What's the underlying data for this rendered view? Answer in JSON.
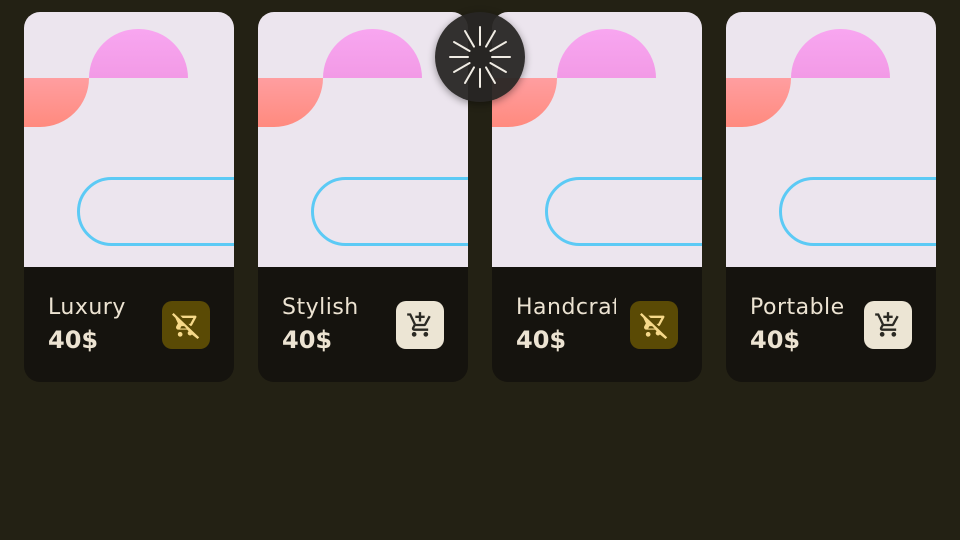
{
  "products": [
    {
      "title": "Luxury",
      "price": "40$",
      "in_cart": true,
      "cart_icon": "remove-shopping-cart-icon"
    },
    {
      "title": "Stylish",
      "price": "40$",
      "in_cart": false,
      "cart_icon": "add-shopping-cart-icon"
    },
    {
      "title": "Handcrafted",
      "price": "40$",
      "in_cart": true,
      "cart_icon": "remove-shopping-cart-icon"
    },
    {
      "title": "Portable",
      "price": "40$",
      "in_cart": false,
      "cart_icon": "add-shopping-cart-icon"
    }
  ],
  "loading_indicator": {
    "icon": "loading-spinner-icon"
  },
  "colors": {
    "background": "#232114",
    "card_info_bg": "#15130e",
    "image_bg": "#ece5ee",
    "in_cart_button": "#5a4a05",
    "in_cart_icon": "#f6d98a",
    "add_button": "#ece5d4",
    "add_icon": "#2b2a24",
    "pill_outline": "#5ccaf5"
  }
}
